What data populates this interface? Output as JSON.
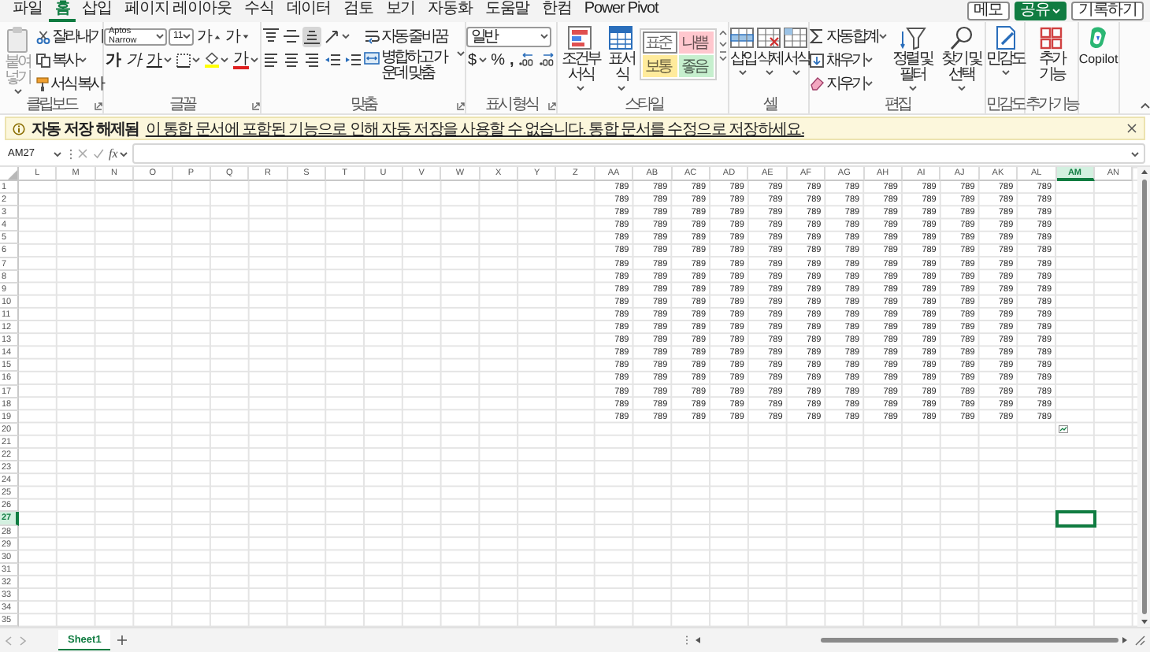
{
  "menu": {
    "tabs": [
      {
        "label": "파일",
        "selected": false
      },
      {
        "label": "홈",
        "selected": true
      },
      {
        "label": "삽입",
        "selected": false
      },
      {
        "label": "페이지 레이아웃",
        "selected": false
      },
      {
        "label": "수식",
        "selected": false
      },
      {
        "label": "데이터",
        "selected": false
      },
      {
        "label": "검토",
        "selected": false
      },
      {
        "label": "보기",
        "selected": false
      },
      {
        "label": "자동화",
        "selected": false
      },
      {
        "label": "도움말",
        "selected": false
      },
      {
        "label": "한컴",
        "selected": false
      },
      {
        "label": "Power Pivot",
        "selected": false
      }
    ],
    "actions": [
      {
        "label": "메모",
        "kind": "outline"
      },
      {
        "label": "공유",
        "kind": "primary"
      },
      {
        "label": "기록하기",
        "kind": "outline"
      }
    ]
  },
  "ribbon": {
    "groups": [
      {
        "kind": "clipboard",
        "label": "클립보드",
        "launcher": true,
        "paste": {
          "label": "붙여넣기",
          "disabled": true
        },
        "commands": [
          "잘라내기",
          "복사",
          "서식 복사"
        ]
      },
      {
        "kind": "font",
        "label": "글꼴",
        "launcher": true,
        "font_name": "Aptos Narrow",
        "font_size": "11",
        "grow": "가",
        "shrink": "가",
        "bold": "가",
        "italic": "가",
        "underline": "가",
        "font_color": "가"
      },
      {
        "kind": "alignment",
        "label": "맞춤",
        "launcher": true,
        "vertical": [
          {
            "selected": false
          },
          {
            "selected": false
          },
          {
            "selected": true
          }
        ],
        "wrap": "자동 줄 바꿈",
        "merge": "병합하고 가운데 맞춤"
      },
      {
        "kind": "number",
        "label": "표시 형식",
        "launcher": true,
        "format": "일반",
        "currency": "$",
        "percent": "%",
        "comma": ","
      },
      {
        "kind": "styles",
        "label": "스타일",
        "conditional": "조건부 서식",
        "table": "표 서식",
        "cell_styles": [
          {
            "label": "표준",
            "color": "#ffffff"
          },
          {
            "label": "나쁨",
            "color": "#ffc7ce"
          },
          {
            "label": "보통",
            "color": "#ffeb9c"
          },
          {
            "label": "좋음",
            "color": "#c6efce"
          }
        ]
      },
      {
        "kind": "cells",
        "label": "셀",
        "commands": [
          "삽입",
          "삭제",
          "서식"
        ]
      },
      {
        "kind": "editing",
        "label": "편집",
        "commands": [
          "자동 합계",
          "채우기",
          "지우기"
        ],
        "sort": "정렬 및 필터",
        "find": "찾기 및 선택"
      },
      {
        "kind": "sensitivity",
        "label": "민감도",
        "command": "민감도"
      },
      {
        "kind": "addins",
        "label": "추가 기능",
        "command": "추가 기능"
      },
      {
        "kind": "copilot",
        "command": "Copilot"
      }
    ]
  },
  "info_bar": {
    "title": "자동 저장 해제됨",
    "message": "이 통합 문서에 포함된 기능으로 인해 자동 저장을 사용할 수 없습니다. 통합 문서를 수정으로 저장하세요."
  },
  "formula_bar": {
    "name_box": "AM27",
    "function_label": "fx"
  },
  "sheet": {
    "columns": [
      {
        "label": "L",
        "selected": false
      },
      {
        "label": "M",
        "selected": false
      },
      {
        "label": "N",
        "selected": false
      },
      {
        "label": "O",
        "selected": false
      },
      {
        "label": "P",
        "selected": false
      },
      {
        "label": "Q",
        "selected": false
      },
      {
        "label": "R",
        "selected": false
      },
      {
        "label": "S",
        "selected": false
      },
      {
        "label": "T",
        "selected": false
      },
      {
        "label": "U",
        "selected": false
      },
      {
        "label": "V",
        "selected": false
      },
      {
        "label": "W",
        "selected": false
      },
      {
        "label": "X",
        "selected": false
      },
      {
        "label": "Y",
        "selected": false
      },
      {
        "label": "Z",
        "selected": false
      },
      {
        "label": "AA",
        "selected": false
      },
      {
        "label": "AB",
        "selected": false
      },
      {
        "label": "AC",
        "selected": false
      },
      {
        "label": "AD",
        "selected": false
      },
      {
        "label": "AE",
        "selected": false
      },
      {
        "label": "AF",
        "selected": false
      },
      {
        "label": "AG",
        "selected": false
      },
      {
        "label": "AH",
        "selected": false
      },
      {
        "label": "AI",
        "selected": false
      },
      {
        "label": "AJ",
        "selected": false
      },
      {
        "label": "AK",
        "selected": false
      },
      {
        "label": "AL",
        "selected": false
      },
      {
        "label": "AM",
        "selected": true
      },
      {
        "label": "AN",
        "selected": false
      }
    ],
    "rows": [
      {
        "label": "1",
        "selected": false,
        "cells": [
          null,
          null,
          null,
          null,
          null,
          null,
          null,
          null,
          null,
          null,
          null,
          null,
          null,
          null,
          null,
          "789",
          "789",
          "789",
          "789",
          "789",
          "789",
          "789",
          "789",
          "789",
          "789",
          "789",
          "789"
        ]
      },
      {
        "label": "2",
        "selected": false,
        "cells": [
          null,
          null,
          null,
          null,
          null,
          null,
          null,
          null,
          null,
          null,
          null,
          null,
          null,
          null,
          null,
          "789",
          "789",
          "789",
          "789",
          "789",
          "789",
          "789",
          "789",
          "789",
          "789",
          "789",
          "789"
        ]
      },
      {
        "label": "3",
        "selected": false,
        "cells": [
          null,
          null,
          null,
          null,
          null,
          null,
          null,
          null,
          null,
          null,
          null,
          null,
          null,
          null,
          null,
          "789",
          "789",
          "789",
          "789",
          "789",
          "789",
          "789",
          "789",
          "789",
          "789",
          "789",
          "789"
        ]
      },
      {
        "label": "4",
        "selected": false,
        "cells": [
          null,
          null,
          null,
          null,
          null,
          null,
          null,
          null,
          null,
          null,
          null,
          null,
          null,
          null,
          null,
          "789",
          "789",
          "789",
          "789",
          "789",
          "789",
          "789",
          "789",
          "789",
          "789",
          "789",
          "789"
        ]
      },
      {
        "label": "5",
        "selected": false,
        "cells": [
          null,
          null,
          null,
          null,
          null,
          null,
          null,
          null,
          null,
          null,
          null,
          null,
          null,
          null,
          null,
          "789",
          "789",
          "789",
          "789",
          "789",
          "789",
          "789",
          "789",
          "789",
          "789",
          "789",
          "789"
        ]
      },
      {
        "label": "6",
        "selected": false,
        "cells": [
          null,
          null,
          null,
          null,
          null,
          null,
          null,
          null,
          null,
          null,
          null,
          null,
          null,
          null,
          null,
          "789",
          "789",
          "789",
          "789",
          "789",
          "789",
          "789",
          "789",
          "789",
          "789",
          "789",
          "789"
        ]
      },
      {
        "label": "7",
        "selected": false,
        "cells": [
          null,
          null,
          null,
          null,
          null,
          null,
          null,
          null,
          null,
          null,
          null,
          null,
          null,
          null,
          null,
          "789",
          "789",
          "789",
          "789",
          "789",
          "789",
          "789",
          "789",
          "789",
          "789",
          "789",
          "789"
        ]
      },
      {
        "label": "8",
        "selected": false,
        "cells": [
          null,
          null,
          null,
          null,
          null,
          null,
          null,
          null,
          null,
          null,
          null,
          null,
          null,
          null,
          null,
          "789",
          "789",
          "789",
          "789",
          "789",
          "789",
          "789",
          "789",
          "789",
          "789",
          "789",
          "789"
        ]
      },
      {
        "label": "9",
        "selected": false,
        "cells": [
          null,
          null,
          null,
          null,
          null,
          null,
          null,
          null,
          null,
          null,
          null,
          null,
          null,
          null,
          null,
          "789",
          "789",
          "789",
          "789",
          "789",
          "789",
          "789",
          "789",
          "789",
          "789",
          "789",
          "789"
        ]
      },
      {
        "label": "10",
        "selected": false,
        "cells": [
          null,
          null,
          null,
          null,
          null,
          null,
          null,
          null,
          null,
          null,
          null,
          null,
          null,
          null,
          null,
          "789",
          "789",
          "789",
          "789",
          "789",
          "789",
          "789",
          "789",
          "789",
          "789",
          "789",
          "789"
        ]
      },
      {
        "label": "11",
        "selected": false,
        "cells": [
          null,
          null,
          null,
          null,
          null,
          null,
          null,
          null,
          null,
          null,
          null,
          null,
          null,
          null,
          null,
          "789",
          "789",
          "789",
          "789",
          "789",
          "789",
          "789",
          "789",
          "789",
          "789",
          "789",
          "789"
        ]
      },
      {
        "label": "12",
        "selected": false,
        "cells": [
          null,
          null,
          null,
          null,
          null,
          null,
          null,
          null,
          null,
          null,
          null,
          null,
          null,
          null,
          null,
          "789",
          "789",
          "789",
          "789",
          "789",
          "789",
          "789",
          "789",
          "789",
          "789",
          "789",
          "789"
        ]
      },
      {
        "label": "13",
        "selected": false,
        "cells": [
          null,
          null,
          null,
          null,
          null,
          null,
          null,
          null,
          null,
          null,
          null,
          null,
          null,
          null,
          null,
          "789",
          "789",
          "789",
          "789",
          "789",
          "789",
          "789",
          "789",
          "789",
          "789",
          "789",
          "789"
        ]
      },
      {
        "label": "14",
        "selected": false,
        "cells": [
          null,
          null,
          null,
          null,
          null,
          null,
          null,
          null,
          null,
          null,
          null,
          null,
          null,
          null,
          null,
          "789",
          "789",
          "789",
          "789",
          "789",
          "789",
          "789",
          "789",
          "789",
          "789",
          "789",
          "789"
        ]
      },
      {
        "label": "15",
        "selected": false,
        "cells": [
          null,
          null,
          null,
          null,
          null,
          null,
          null,
          null,
          null,
          null,
          null,
          null,
          null,
          null,
          null,
          "789",
          "789",
          "789",
          "789",
          "789",
          "789",
          "789",
          "789",
          "789",
          "789",
          "789",
          "789"
        ]
      },
      {
        "label": "16",
        "selected": false,
        "cells": [
          null,
          null,
          null,
          null,
          null,
          null,
          null,
          null,
          null,
          null,
          null,
          null,
          null,
          null,
          null,
          "789",
          "789",
          "789",
          "789",
          "789",
          "789",
          "789",
          "789",
          "789",
          "789",
          "789",
          "789"
        ]
      },
      {
        "label": "17",
        "selected": false,
        "cells": [
          null,
          null,
          null,
          null,
          null,
          null,
          null,
          null,
          null,
          null,
          null,
          null,
          null,
          null,
          null,
          "789",
          "789",
          "789",
          "789",
          "789",
          "789",
          "789",
          "789",
          "789",
          "789",
          "789",
          "789"
        ]
      },
      {
        "label": "18",
        "selected": false,
        "cells": [
          null,
          null,
          null,
          null,
          null,
          null,
          null,
          null,
          null,
          null,
          null,
          null,
          null,
          null,
          null,
          "789",
          "789",
          "789",
          "789",
          "789",
          "789",
          "789",
          "789",
          "789",
          "789",
          "789",
          "789"
        ]
      },
      {
        "label": "19",
        "selected": false,
        "cells": [
          null,
          null,
          null,
          null,
          null,
          null,
          null,
          null,
          null,
          null,
          null,
          null,
          null,
          null,
          null,
          "789",
          "789",
          "789",
          "789",
          "789",
          "789",
          "789",
          "789",
          "789",
          "789",
          "789",
          "789"
        ]
      },
      {
        "label": "20",
        "selected": false
      },
      {
        "label": "21",
        "selected": false
      },
      {
        "label": "22",
        "selected": false
      },
      {
        "label": "23",
        "selected": false
      },
      {
        "label": "24",
        "selected": false
      },
      {
        "label": "25",
        "selected": false
      },
      {
        "label": "26",
        "selected": false
      },
      {
        "label": "27",
        "selected": true
      },
      {
        "label": "28",
        "selected": false
      },
      {
        "label": "29",
        "selected": false
      },
      {
        "label": "30",
        "selected": false
      },
      {
        "label": "31",
        "selected": false
      },
      {
        "label": "32",
        "selected": false
      },
      {
        "label": "33",
        "selected": false
      },
      {
        "label": "34",
        "selected": false
      },
      {
        "label": "35",
        "selected": false
      }
    ]
  },
  "sheet_tabs": [
    {
      "label": "Sheet1",
      "selected": true
    }
  ]
}
